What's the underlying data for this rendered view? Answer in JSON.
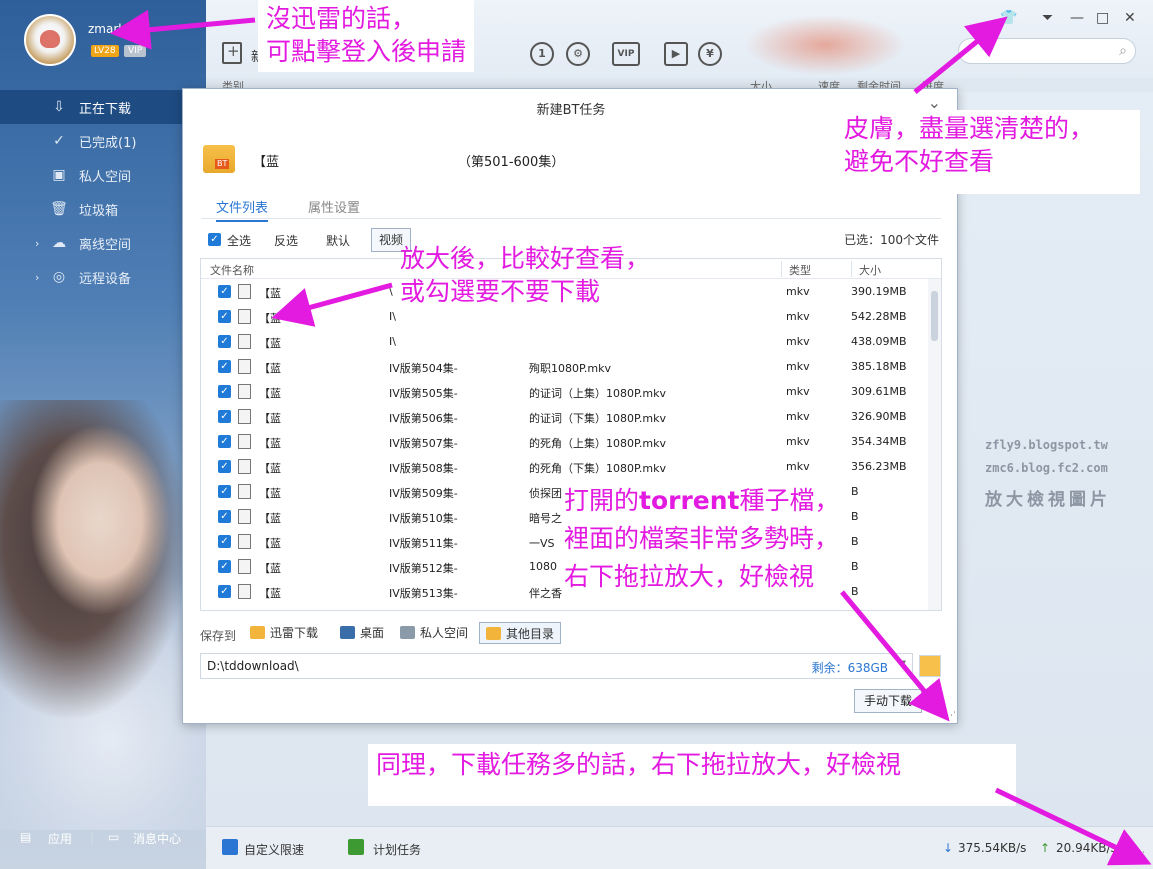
{
  "user": {
    "name": "zmark",
    "level": "LV28",
    "vip": "VIP"
  },
  "sidebar": {
    "items": [
      {
        "label": "正在下载",
        "icon": "download-icon"
      },
      {
        "label": "已完成(1)",
        "icon": "check-circle-icon"
      },
      {
        "label": "私人空间",
        "icon": "lock-icon"
      },
      {
        "label": "垃圾箱",
        "icon": "trash-icon"
      },
      {
        "label": "离线空间",
        "icon": "cloud-icon"
      },
      {
        "label": "远程设备",
        "icon": "globe-icon"
      }
    ],
    "bottom": {
      "apps": "应用",
      "messages": "消息中心"
    }
  },
  "toolbar": {
    "new_label": "新"
  },
  "columns": {
    "type": "类别",
    "size": "大小",
    "speed": "速度",
    "remaining": "剩余时间",
    "progress": "进度"
  },
  "dialog": {
    "title": "新建BT任务",
    "torrent_prefix": "【蓝",
    "torrent_suffix": "（第501-600集）",
    "bt_label": "BT",
    "tabs": [
      "文件列表",
      "属性设置"
    ],
    "filters": {
      "select_all": "全选",
      "invert": "反选",
      "default": "默认",
      "video": "视频"
    },
    "selected_count": "已选：100个文件",
    "headers": {
      "name": "文件名称",
      "type": "类型",
      "size": "大小"
    },
    "rows": [
      {
        "n1": "【蓝",
        "n2": "\\",
        "n3": "",
        "type": "mkv",
        "size": "390.19MB"
      },
      {
        "n1": "【蓝",
        "n2": "I\\",
        "n3": "",
        "type": "mkv",
        "size": "542.28MB"
      },
      {
        "n1": "【蓝",
        "n2": "I\\",
        "n3": "",
        "type": "mkv",
        "size": "438.09MB"
      },
      {
        "n1": "【蓝",
        "n2": "IV版第504集-",
        "n3": "殉职1080P.mkv",
        "type": "mkv",
        "size": "385.18MB"
      },
      {
        "n1": "【蓝",
        "n2": "IV版第505集-",
        "n3": "的证词（上集）1080P.mkv",
        "type": "mkv",
        "size": "309.61MB"
      },
      {
        "n1": "【蓝",
        "n2": "IV版第506集-",
        "n3": "的证词（下集）1080P.mkv",
        "type": "mkv",
        "size": "326.90MB"
      },
      {
        "n1": "【蓝",
        "n2": "IV版第507集-",
        "n3": "的死角（上集）1080P.mkv",
        "type": "mkv",
        "size": "354.34MB"
      },
      {
        "n1": "【蓝",
        "n2": "IV版第508集-",
        "n3": "的死角（下集）1080P.mkv",
        "type": "mkv",
        "size": "356.23MB"
      },
      {
        "n1": "【蓝",
        "n2": "IV版第509集-",
        "n3": "侦探团",
        "type": "",
        "size": "B"
      },
      {
        "n1": "【蓝",
        "n2": "IV版第510集-",
        "n3": "暗号之",
        "type": "",
        "size": "B"
      },
      {
        "n1": "【蓝",
        "n2": "IV版第511集-",
        "n3": "一VS",
        "type": "",
        "size": "B"
      },
      {
        "n1": "【蓝",
        "n2": "IV版第512集-",
        "n3": "1080",
        "type": "",
        "size": "B"
      },
      {
        "n1": "【蓝",
        "n2": "IV版第513集-",
        "n3": "伴之香",
        "type": "",
        "size": "B"
      }
    ],
    "save_to_label": "保存到",
    "save_options": [
      "迅雷下载",
      "桌面",
      "私人空间",
      "其他目录"
    ],
    "path": "D:\\tddownload\\",
    "free_space": "剩余：638GB",
    "manual_download": "手动下载"
  },
  "statusbar": {
    "speed_limit": "自定义限速",
    "schedule": "计划任务",
    "download_speed": "375.54KB/s",
    "upload_speed": "20.94KB/s"
  },
  "watermark": {
    "line1": "zfly9.blogspot.tw",
    "line2": "zmc6.blog.fc2.com",
    "line3": "放大檢視圖片"
  },
  "annotations": {
    "login_line1": "沒迅雷的話，",
    "login_line2": "可點擊登入後申請",
    "skin_line1": "皮膚，盡量選清楚的，",
    "skin_line2": "避免不好查看",
    "zoom_line1": "放大後，比較好查看，",
    "zoom_line2": "或勾選要不要下載",
    "torrent_line1_a": "打開的",
    "torrent_line1_b": "torrent",
    "torrent_line1_c": "種子檔，",
    "torrent_line2": "裡面的檔案非常多勢時，",
    "torrent_line3": "右下拖拉放大，好檢視",
    "tasks_line": "同理，下載任務多的話，右下拖拉放大，好檢視"
  },
  "colors": {
    "annotation": "#e31ae0",
    "accent": "#2a76d2",
    "sidebar_active": "#1e4b82"
  }
}
